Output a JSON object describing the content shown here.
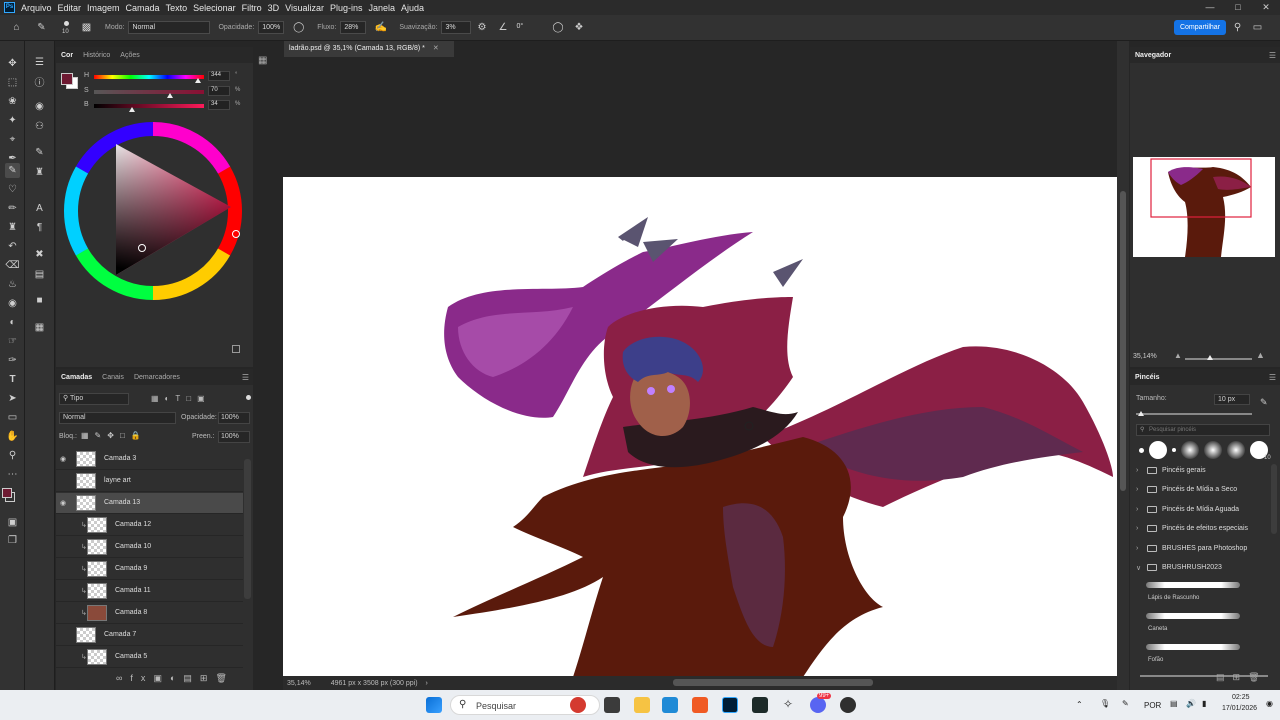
{
  "menu": {
    "items": [
      "Arquivo",
      "Editar",
      "Imagem",
      "Camada",
      "Texto",
      "Selecionar",
      "Filtro",
      "3D",
      "Visualizar",
      "Plug-ins",
      "Janela",
      "Ajuda"
    ]
  },
  "options": {
    "brush_size": "10",
    "mode_label": "Modo:",
    "mode_value": "Normal",
    "opacity_label": "Opacidade:",
    "opacity_value": "100%",
    "flow_label": "Fluxo:",
    "flow_value": "28%",
    "smoothing_label": "Suavização:",
    "smoothing_value": "3%",
    "angle_value": "0°",
    "share_label": "Compartilhar"
  },
  "color_panel": {
    "tabs": [
      "Cor",
      "Histórico",
      "Ações"
    ],
    "h_label": "H",
    "h_value": "344",
    "h_unit": "°",
    "s_label": "S",
    "s_value": "70",
    "s_unit": "%",
    "b_label": "B",
    "b_value": "34",
    "b_unit": "%",
    "fg_color": "#6e1a32",
    "bg_color": "#ffffff",
    "selected_color": "#5a1a2c"
  },
  "layers_panel": {
    "tabs": [
      "Camadas",
      "Canais",
      "Demarcadores"
    ],
    "filter_label": "Tipo",
    "blend_mode": "Normal",
    "opacity_label": "Opacidade:",
    "opacity_value": "100%",
    "lock_label": "Bloq.:",
    "fill_label": "Preen.:",
    "fill_value": "100%",
    "layers": [
      {
        "name": "Camada 3",
        "visible": true,
        "clipped": false,
        "selected": false
      },
      {
        "name": "layne art",
        "visible": false,
        "clipped": false,
        "selected": false
      },
      {
        "name": "Camada 13",
        "visible": true,
        "clipped": false,
        "selected": true
      },
      {
        "name": "Camada 12",
        "visible": false,
        "clipped": true,
        "selected": false
      },
      {
        "name": "Camada 10",
        "visible": false,
        "clipped": true,
        "selected": false
      },
      {
        "name": "Camada 9",
        "visible": false,
        "clipped": true,
        "selected": false
      },
      {
        "name": "Camada 11",
        "visible": false,
        "clipped": true,
        "selected": false
      },
      {
        "name": "Camada 8",
        "visible": false,
        "clipped": true,
        "selected": false
      },
      {
        "name": "Camada 7",
        "visible": false,
        "clipped": false,
        "selected": false
      },
      {
        "name": "Camada 5",
        "visible": false,
        "clipped": true,
        "selected": false
      }
    ]
  },
  "document": {
    "tab_title": "ladrão.psd @ 35,1% (Camada 13, RGB/8) *",
    "zoom": "35,14%",
    "dimensions": "4961 px x 3508 px (300 ppi)"
  },
  "navigator": {
    "title": "Navegador",
    "zoom": "35,14%"
  },
  "brushes_panel": {
    "title": "Pincéis",
    "size_label": "Tamanho:",
    "size_value": "10 px",
    "search_placeholder": "Pesquisar pincéis",
    "preset_size": "10",
    "folders": [
      "Pincéis gerais",
      "Pincéis de Mídia a Seco",
      "Pincéis de Mídia Aguada",
      "Pincéis de efeitos especiais",
      "BRUSHES para Photoshop",
      "BRUSHRUSH2023"
    ],
    "brushes": [
      "Lápis de Rascunho",
      "Caneta",
      "Fofão"
    ]
  },
  "taskbar": {
    "search_placeholder": "Pesquisar",
    "language": "POR",
    "time": "02:25",
    "date": "17/01/2026",
    "badge": "99+"
  }
}
